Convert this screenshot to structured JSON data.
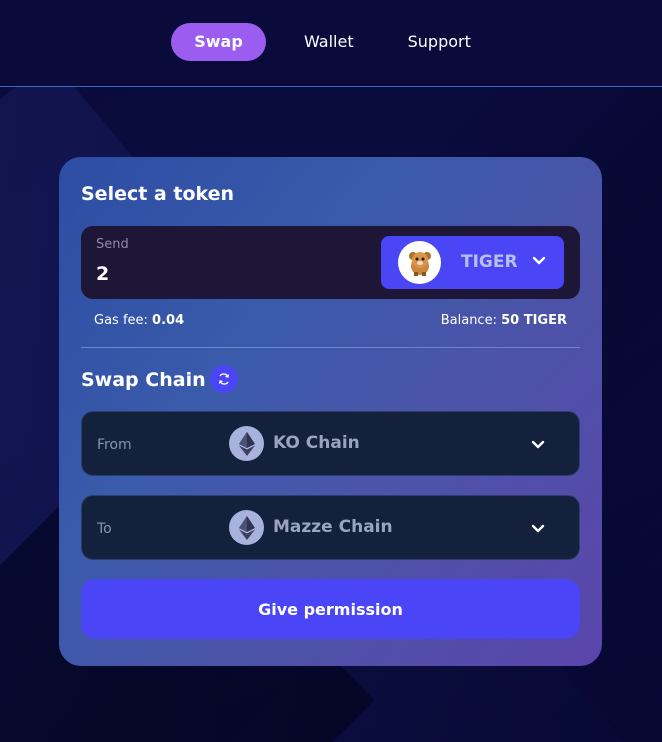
{
  "nav": {
    "items": [
      {
        "label": "Swap",
        "active": true
      },
      {
        "label": "Wallet",
        "active": false
      },
      {
        "label": "Support",
        "active": false
      }
    ]
  },
  "card": {
    "title": "Select a token",
    "send": {
      "label": "Send",
      "value": "2"
    },
    "token": {
      "name": "TIGER",
      "icon": "tiger-icon"
    },
    "gas_fee": {
      "label": "Gas fee:",
      "value": "0.04"
    },
    "balance": {
      "label": "Balance:",
      "value": "50 TIGER"
    },
    "swap_chain": {
      "title": "Swap Chain",
      "refresh_icon": "refresh-icon",
      "from": {
        "label": "From",
        "chain": "KO Chain",
        "icon": "ethereum-icon"
      },
      "to": {
        "label": "To",
        "chain": "Mazze Chain",
        "icon": "ethereum-icon"
      }
    },
    "permission_button": "Give permission"
  },
  "colors": {
    "background": "#0b0c3d",
    "accent_purple": "#9b5cf0",
    "primary_button": "#4a46f7",
    "send_box": "#1e1636",
    "chain_box": "#13213d"
  }
}
